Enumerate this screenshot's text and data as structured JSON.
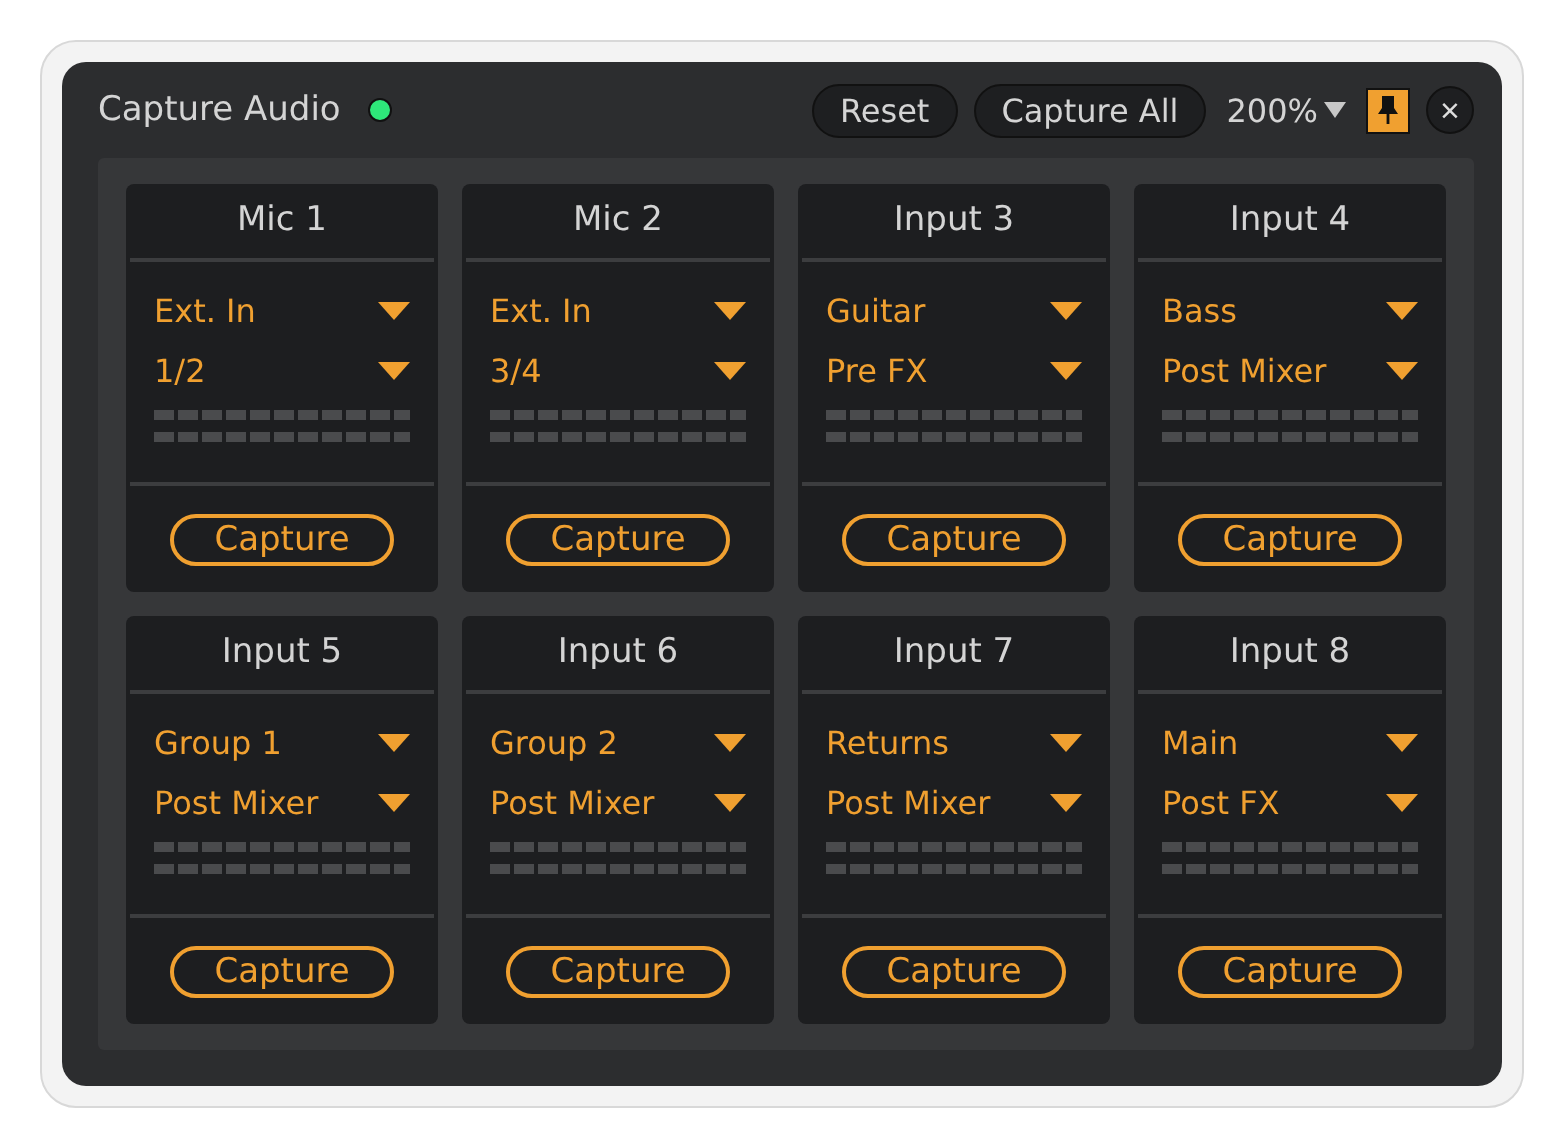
{
  "window": {
    "title": "Capture Audio",
    "status_on": true,
    "zoom": "200%",
    "pinned": true,
    "close": "×"
  },
  "toolbar": {
    "buttons": [
      "Reset",
      "Capture All"
    ]
  },
  "channels": [
    {
      "name": "Mic 1",
      "source": "Ext. In",
      "tap": "1/2",
      "button": "Capture"
    },
    {
      "name": "Mic 2",
      "source": "Ext. In",
      "tap": "3/4",
      "button": "Capture"
    },
    {
      "name": "Input 3",
      "source": "Guitar",
      "tap": "Pre FX",
      "button": "Capture"
    },
    {
      "name": "Input 4",
      "source": "Bass",
      "tap": "Post Mixer",
      "button": "Capture"
    },
    {
      "name": "Input 5",
      "source": "Group 1",
      "tap": "Post Mixer",
      "button": "Capture"
    },
    {
      "name": "Input 6",
      "source": "Group 2",
      "tap": "Post Mixer",
      "button": "Capture"
    },
    {
      "name": "Input 7",
      "source": "Returns",
      "tap": "Post Mixer",
      "button": "Capture"
    },
    {
      "name": "Input 8",
      "source": "Main",
      "tap": "Post FX",
      "button": "Capture"
    }
  ]
}
